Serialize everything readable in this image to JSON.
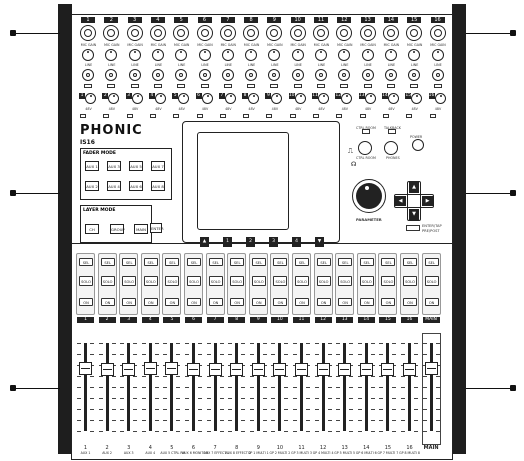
{
  "brand": {
    "logo_text": "PHONIC",
    "model": "IS16"
  },
  "channels": [
    "1",
    "2",
    "3",
    "4",
    "5",
    "6",
    "7",
    "8",
    "9",
    "10",
    "11",
    "12",
    "13",
    "14",
    "15",
    "16"
  ],
  "strip_labels": {
    "phantom": "48V",
    "mic_gain": "MIC GAIN",
    "line": "LINE",
    "peak": "PEAK",
    "signal": "SIGNAL"
  },
  "fader_mode": {
    "title": "FADER MODE",
    "row1": [
      "AUX 1",
      "AUX 3",
      "AUX 5",
      "AUX 7"
    ],
    "row2": [
      "AUX 2",
      "AUX 4",
      "AUX 6",
      "AUX 8"
    ]
  },
  "layer_mode": {
    "title": "LAYER MODE",
    "buttons": [
      "CH",
      "GROUP",
      "MAIN"
    ],
    "extra": "ENTER"
  },
  "control_labels": {
    "ctrl_room": "CTRL ROOM",
    "talkback": "TALKBACK",
    "phones": "PHONES",
    "power": "POWER",
    "parameter": "PARAMETER",
    "enter_pre_post": "ENTER/TAP",
    "pre_post": "PRE/POST"
  },
  "navigation": {
    "up": "▲",
    "left": "◀",
    "right": "▶",
    "down": "▼"
  },
  "bank_buttons": [
    "▲",
    "1",
    "2",
    "3",
    "4",
    "▼"
  ],
  "channel_button_labels": {
    "sel": "SEL",
    "solo": "SOLO",
    "on": "ON"
  },
  "main_label": "MAIN",
  "fader_scale": [
    "10",
    "5",
    "0",
    "5",
    "10",
    "20",
    "30",
    "40",
    "∞"
  ],
  "fader_labels": [
    {
      "num": "1",
      "sub": "AUX 1"
    },
    {
      "num": "2",
      "sub": "AUX 2"
    },
    {
      "num": "3",
      "sub": "AUX 3"
    },
    {
      "num": "4",
      "sub": "AUX 4"
    },
    {
      "num": "5",
      "sub": "AUX 5 CTRL RM"
    },
    {
      "num": "6",
      "sub": "AUX 6 MONITOR"
    },
    {
      "num": "7",
      "sub": "AUX 7 EFFECT 1"
    },
    {
      "num": "8",
      "sub": "AUX 8 EFFECT 2"
    },
    {
      "num": "9",
      "sub": "GP 1 MULTI 1"
    },
    {
      "num": "10",
      "sub": "GP 2 MULTI 2"
    },
    {
      "num": "11",
      "sub": "GP 3 MULTI 3"
    },
    {
      "num": "12",
      "sub": "GP 4 MULTI 4"
    },
    {
      "num": "13",
      "sub": "GP 5 MULTI 5"
    },
    {
      "num": "14",
      "sub": "GP 6 MULTI 6"
    },
    {
      "num": "15",
      "sub": "GP 7 MULTI 7"
    },
    {
      "num": "16",
      "sub": "GP 8 MULTI 8"
    }
  ],
  "fader_levels": [
    0.72,
    0.7,
    0.71,
    0.72,
    0.72,
    0.7,
    0.7,
    0.7,
    0.7,
    0.7,
    0.7,
    0.7,
    0.7,
    0.7,
    0.7,
    0.7
  ],
  "main_fader_level": 0.72,
  "colors": {
    "panel": "#ffffff",
    "ink": "#222222",
    "wings": "#1e1e1e"
  }
}
